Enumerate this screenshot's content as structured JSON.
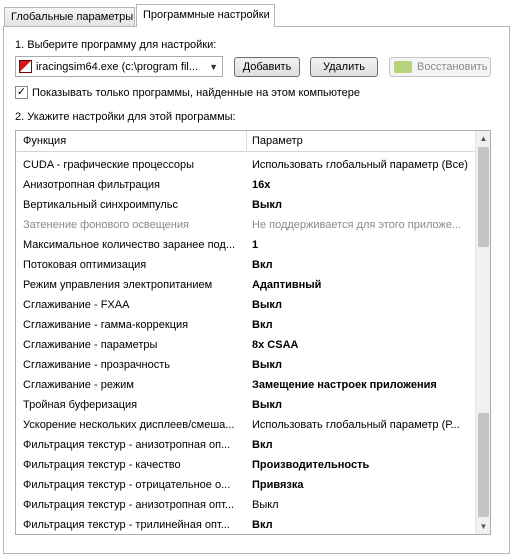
{
  "tabs": [
    {
      "label": "Глобальные параметры",
      "active": false
    },
    {
      "label": "Программные настройки",
      "active": true
    }
  ],
  "step1_label": "1. Выберите программу для настройки:",
  "program_select": {
    "value": "iracingsim64.exe (c:\\program fil..."
  },
  "buttons": {
    "add": "Добавить",
    "remove": "Удалить",
    "restore": "Восстановить"
  },
  "show_only_found": {
    "label": "Показывать только программы, найденные на этом компьютере",
    "checked": true
  },
  "step2_label": "2. Укажите настройки для этой программы:",
  "grid": {
    "headers": {
      "feature": "Функция",
      "setting": "Параметр"
    },
    "rows": [
      {
        "feature": "CUDA - графические процессоры",
        "setting": "Использовать глобальный параметр (Все)",
        "bold": false,
        "disabled": false
      },
      {
        "feature": "Анизотропная фильтрация",
        "setting": "16x",
        "bold": true,
        "disabled": false
      },
      {
        "feature": "Вертикальный синхроимпульс",
        "setting": "Выкл",
        "bold": true,
        "disabled": false
      },
      {
        "feature": "Затенение фонового освещения",
        "setting": "Не поддерживается для этого приложе...",
        "bold": false,
        "disabled": true
      },
      {
        "feature": "Максимальное количество заранее под...",
        "setting": "1",
        "bold": true,
        "disabled": false
      },
      {
        "feature": "Потоковая оптимизация",
        "setting": "Вкл",
        "bold": true,
        "disabled": false
      },
      {
        "feature": "Режим управления электропитанием",
        "setting": "Адаптивный",
        "bold": true,
        "disabled": false
      },
      {
        "feature": "Сглаживание - FXAA",
        "setting": "Выкл",
        "bold": true,
        "disabled": false
      },
      {
        "feature": "Сглаживание - гамма-коррекция",
        "setting": "Вкл",
        "bold": true,
        "disabled": false
      },
      {
        "feature": "Сглаживание - параметры",
        "setting": "8x CSAA",
        "bold": true,
        "disabled": false
      },
      {
        "feature": "Сглаживание - прозрачность",
        "setting": "Выкл",
        "bold": true,
        "disabled": false
      },
      {
        "feature": "Сглаживание - режим",
        "setting": "Замещение настроек приложения",
        "bold": true,
        "disabled": false
      },
      {
        "feature": "Тройная буферизация",
        "setting": "Выкл",
        "bold": true,
        "disabled": false
      },
      {
        "feature": "Ускорение нескольких дисплеев/смеша...",
        "setting": "Использовать глобальный параметр (Р...",
        "bold": false,
        "disabled": false
      },
      {
        "feature": "Фильтрация текстур - анизотропная оп...",
        "setting": "Вкл",
        "bold": true,
        "disabled": false
      },
      {
        "feature": "Фильтрация текстур - качество",
        "setting": "Производительность",
        "bold": true,
        "disabled": false
      },
      {
        "feature": "Фильтрация текстур - отрицательное о...",
        "setting": "Привязка",
        "bold": true,
        "disabled": false
      },
      {
        "feature": "Фильтрация текстур - анизотропная опт...",
        "setting": "Выкл",
        "bold": false,
        "disabled": false
      },
      {
        "feature": "Фильтрация текстур - трилинейная опт...",
        "setting": "Вкл",
        "bold": true,
        "disabled": false
      }
    ]
  },
  "icons": {
    "program": "application-icon",
    "restore": "nvidia-logo-icon",
    "dropdown": "chevron-down-icon"
  }
}
